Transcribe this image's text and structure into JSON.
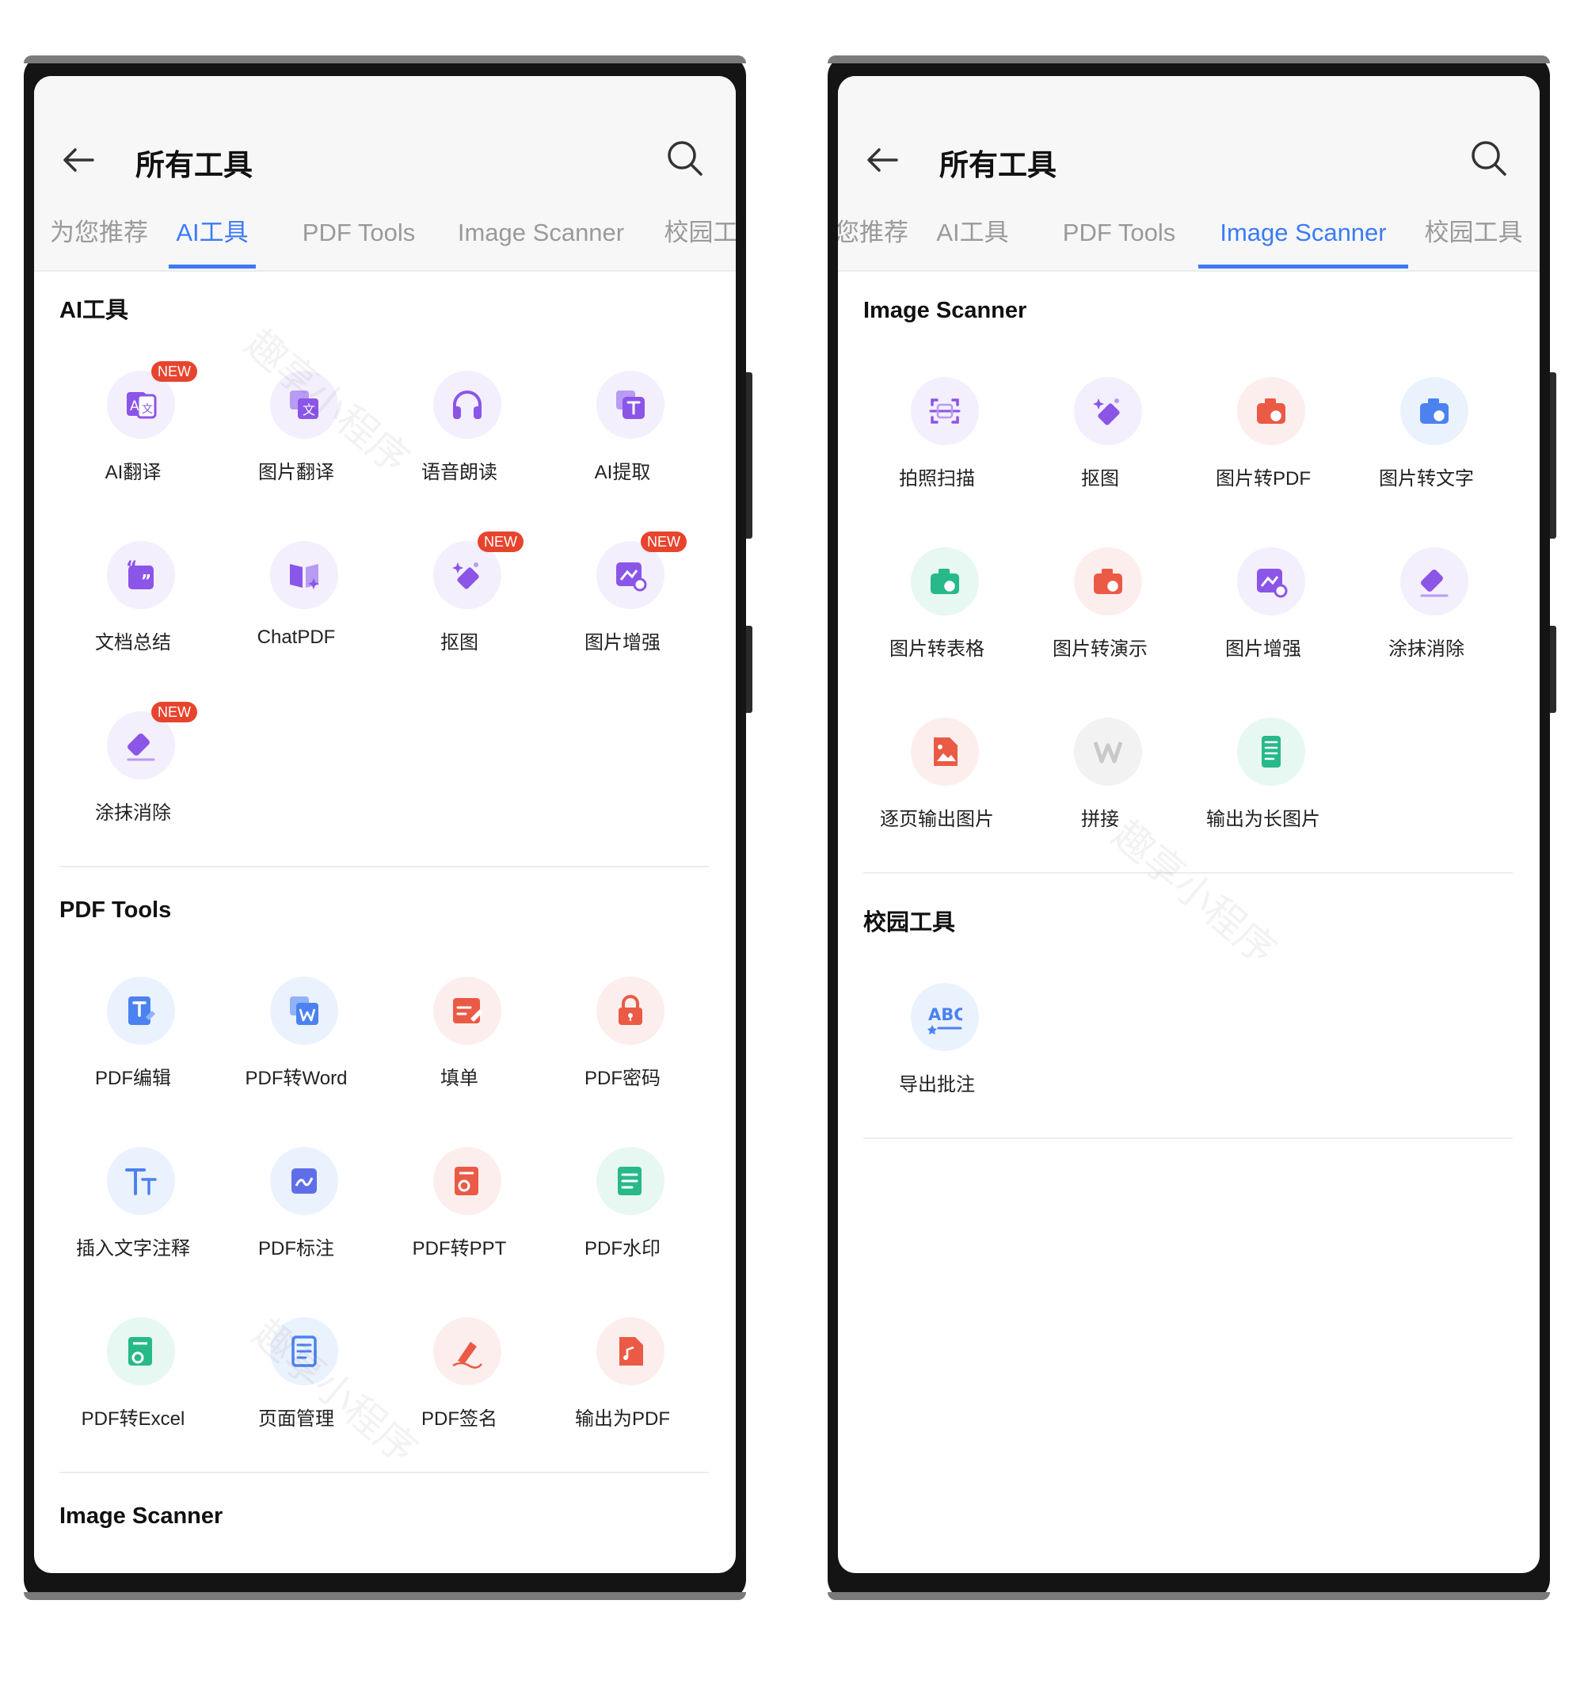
{
  "left": {
    "header": {
      "title": "所有工具"
    },
    "tabs": [
      "为您推荐",
      "AI工具",
      "PDF Tools",
      "Image Scanner",
      "校园工具"
    ],
    "sections": [
      {
        "title": "AI工具",
        "tools": [
          {
            "label": "AI翻译",
            "badge": "NEW",
            "icon": "translate-icon"
          },
          {
            "label": "图片翻译",
            "icon": "image-translate-icon"
          },
          {
            "label": "语音朗读",
            "icon": "headphones-icon"
          },
          {
            "label": "AI提取",
            "icon": "text-extract-icon"
          },
          {
            "label": "文档总结",
            "icon": "quote-summary-icon"
          },
          {
            "label": "ChatPDF",
            "icon": "chat-book-icon"
          },
          {
            "label": "抠图",
            "badge": "NEW",
            "icon": "magic-wand-icon"
          },
          {
            "label": "图片增强",
            "badge": "NEW",
            "icon": "image-enhance-icon"
          },
          {
            "label": "涂抹消除",
            "badge": "NEW",
            "icon": "eraser-icon"
          }
        ]
      },
      {
        "title": "PDF Tools",
        "tools": [
          {
            "label": "PDF编辑",
            "icon": "pdf-edit-icon"
          },
          {
            "label": "PDF转Word",
            "icon": "word-icon"
          },
          {
            "label": "填单",
            "icon": "form-fill-icon"
          },
          {
            "label": "PDF密码",
            "icon": "lock-icon"
          },
          {
            "label": "插入文字注释",
            "icon": "text-size-icon"
          },
          {
            "label": "PDF标注",
            "icon": "annotate-icon"
          },
          {
            "label": "PDF转PPT",
            "icon": "ppt-icon"
          },
          {
            "label": "PDF水印",
            "icon": "watermark-icon"
          },
          {
            "label": "PDF转Excel",
            "icon": "excel-icon"
          },
          {
            "label": "页面管理",
            "icon": "page-manage-icon"
          },
          {
            "label": "PDF签名",
            "icon": "signature-icon"
          },
          {
            "label": "输出为PDF",
            "icon": "export-pdf-icon"
          }
        ]
      },
      {
        "title": "Image Scanner",
        "tools": []
      }
    ]
  },
  "right": {
    "header": {
      "title": "所有工具"
    },
    "tabs": [
      "为您推荐",
      "AI工具",
      "PDF Tools",
      "Image Scanner",
      "校园工具"
    ],
    "sections": [
      {
        "title": "Image Scanner",
        "tools": [
          {
            "label": "拍照扫描",
            "icon": "scan-icon"
          },
          {
            "label": "抠图",
            "icon": "magic-wand-icon"
          },
          {
            "label": "图片转PDF",
            "icon": "camera-pdf-icon"
          },
          {
            "label": "图片转文字",
            "icon": "camera-text-icon"
          },
          {
            "label": "图片转表格",
            "icon": "camera-sheet-icon"
          },
          {
            "label": "图片转演示",
            "icon": "camera-ppt-icon"
          },
          {
            "label": "图片增强",
            "icon": "image-enhance-icon"
          },
          {
            "label": "涂抹消除",
            "icon": "eraser-icon"
          },
          {
            "label": "逐页输出图片",
            "icon": "image-file-icon"
          },
          {
            "label": "拼接",
            "icon": "stitch-icon"
          },
          {
            "label": "输出为长图片",
            "icon": "long-image-icon"
          }
        ]
      },
      {
        "title": "校园工具",
        "tools": [
          {
            "label": "导出批注",
            "icon": "abc-icon"
          }
        ]
      }
    ]
  },
  "watermark": "趣享小程序",
  "colors": {
    "accent": "#3b7bf6",
    "badge": "#e7442e",
    "purple": "#8b55e8",
    "blue": "#4c82f0",
    "red": "#ea5a45",
    "green": "#27b989"
  }
}
